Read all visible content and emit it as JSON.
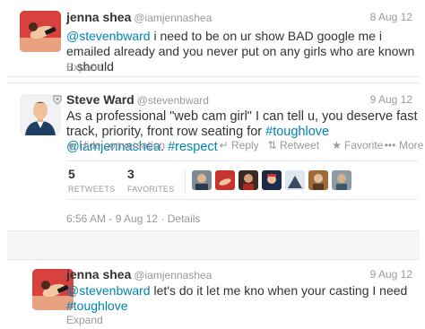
{
  "tweets": [
    {
      "name": "jenna shea",
      "handle": "@iamjennashea",
      "date": "8 Aug 12",
      "text_parts": [
        {
          "t": "@stevenbward",
          "type": "mention"
        },
        {
          "t": " i need to be on ur show BAD  google me i emailed already and you never put on any girls who are known u should",
          "type": "text"
        }
      ],
      "expand": "Expand"
    },
    {
      "name": "Steve Ward",
      "handle": "@stevenbward",
      "date": "9 Aug 12",
      "text_parts": [
        {
          "t": "As a professional \"web cam girl\" I can tell u, you deserve fast track, priority, front row seating for ",
          "type": "text"
        },
        {
          "t": "#toughlove",
          "type": "hashtag"
        },
        {
          "t": " ",
          "type": "text"
        },
        {
          "t": "@iamjennashea",
          "type": "mention"
        },
        {
          "t": ". ",
          "type": "text"
        },
        {
          "t": "#respect",
          "type": "hashtag"
        }
      ],
      "actions": {
        "hide": "Hide conversation",
        "reply": "Reply",
        "retweet": "Retweet",
        "favorite": "Favorite",
        "more": "More"
      },
      "stats": {
        "retweets_count": "5",
        "retweets_label": "RETWEETS",
        "favorites_count": "3",
        "favorites_label": "FAVORITES"
      },
      "timestamp": "6:56 AM - 9 Aug 12 · Details"
    },
    {
      "name": "jenna shea",
      "handle": "@iamjennashea",
      "date": "9 Aug 12",
      "text_parts": [
        {
          "t": "@stevenbward",
          "type": "mention"
        },
        {
          "t": " let's do it let me kno when your casting I need ",
          "type": "text"
        },
        {
          "t": "#toughlove",
          "type": "hashtag"
        }
      ],
      "expand": "Expand"
    }
  ],
  "icons": {
    "verified": "verified-badge-icon",
    "hide": "conversation-icon",
    "reply": "reply-arrow-icon",
    "retweet": "retweet-icon",
    "favorite": "star-icon",
    "more": "ellipsis-icon"
  },
  "colors": {
    "link": "#0084b4",
    "muted": "#999999",
    "text": "#333333",
    "gap": "#f5f5f5"
  }
}
